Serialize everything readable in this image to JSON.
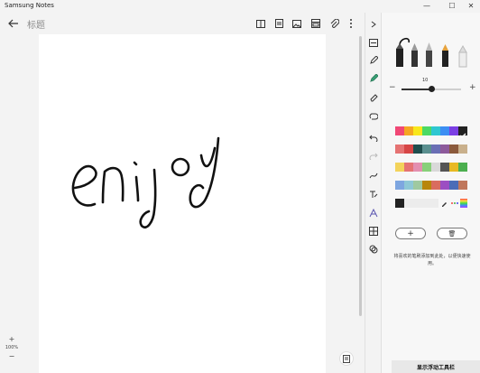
{
  "window": {
    "title": "Samsung Notes",
    "minimize": "—",
    "maximize": "☐",
    "close": "✕"
  },
  "toolbar": {
    "note_title": "标题"
  },
  "canvas": {
    "handwriting": "enjoy"
  },
  "zoom": {
    "plus": "+",
    "percent": "100%",
    "minus": "−"
  },
  "pen_panel": {
    "size_value": "10",
    "size_level": 0.5,
    "minus": "−",
    "plus": "+",
    "colors": [
      [
        "#f04876",
        "#f5a623",
        "#f8e71c",
        "#4cd964",
        "#2ec7d1",
        "#3c8ef3",
        "#7b3fe4",
        "#222222"
      ],
      [
        "#e57373",
        "#d64545",
        "#1f4e4e",
        "#5a8f8f",
        "#6a6fb5",
        "#8d5a9b",
        "#8b5a3c",
        "#c9b08c"
      ],
      [
        "#f3d35b",
        "#e57373",
        "#e38fb0",
        "#88d07a",
        "#d9d9d9",
        "#555555",
        "#e8b923",
        "#4caf50"
      ],
      [
        "#7ea6e0",
        "#8ec7d6",
        "#9fc9a0",
        "#b8860b",
        "#d96c5f",
        "#9c4ec2",
        "#4b6cb7",
        "#c0775c"
      ]
    ],
    "custom_black": "#222222",
    "selected_color": "#222222",
    "add_label": "+",
    "delete_label": "🗑",
    "hint": "将喜欢的笔刷添加到此处，以便快速使用。"
  },
  "floating_toolbar": {
    "label": "显示浮动工具栏"
  }
}
